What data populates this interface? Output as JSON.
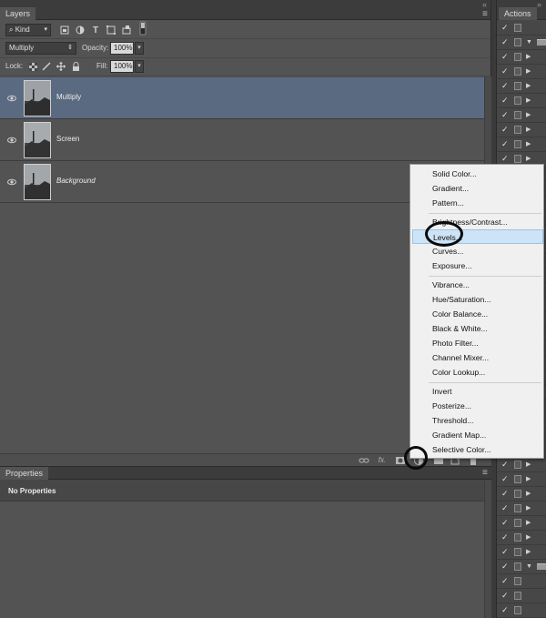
{
  "layers_panel": {
    "tab_title": "Layers",
    "collapse_glyph": "«",
    "filter": {
      "kind_value": "Kind",
      "icons": [
        "image-filter-icon",
        "adjustment-filter-icon",
        "type-filter-icon",
        "shape-filter-icon",
        "smart-object-filter-icon",
        "filter-toggle-icon"
      ]
    },
    "blend_mode": "Multiply",
    "opacity_label": "Opacity:",
    "opacity_value": "100%",
    "lock_label": "Lock:",
    "fill_label": "Fill:",
    "fill_value": "100%",
    "layers": [
      {
        "name": "Multiply",
        "selected": true,
        "italic": false
      },
      {
        "name": "Screen",
        "selected": false,
        "italic": false
      },
      {
        "name": "Background",
        "selected": false,
        "italic": true
      }
    ],
    "footer_icons": [
      "link-layers-icon",
      "fx-icon",
      "add-mask-icon",
      "adjustment-layer-icon",
      "new-group-icon",
      "new-layer-icon",
      "trash-icon"
    ],
    "fx_text": "fx."
  },
  "properties_panel": {
    "tab_title": "Properties",
    "empty_text": "No Properties"
  },
  "actions_panel": {
    "tab_title": "Actions",
    "collapse_glyph": "»"
  },
  "adjustment_menu": {
    "groups": [
      [
        "Solid Color...",
        "Gradient...",
        "Pattern..."
      ],
      [
        "Brightness/Contrast...",
        "Levels...",
        "Curves...",
        "Exposure..."
      ],
      [
        "Vibrance...",
        "Hue/Saturation...",
        "Color Balance...",
        "Black & White...",
        "Photo Filter...",
        "Channel Mixer...",
        "Color Lookup..."
      ],
      [
        "Invert",
        "Posterize...",
        "Threshold...",
        "Gradient Map...",
        "Selective Color..."
      ]
    ],
    "highlighted": "Levels..."
  },
  "colors": {
    "panel_bg": "#535353",
    "selected_layer": "#5a6a80",
    "menu_bg": "#f0f0f0",
    "menu_highlight": "#cde3f6",
    "annotation_ring": "#0a0a0a"
  }
}
